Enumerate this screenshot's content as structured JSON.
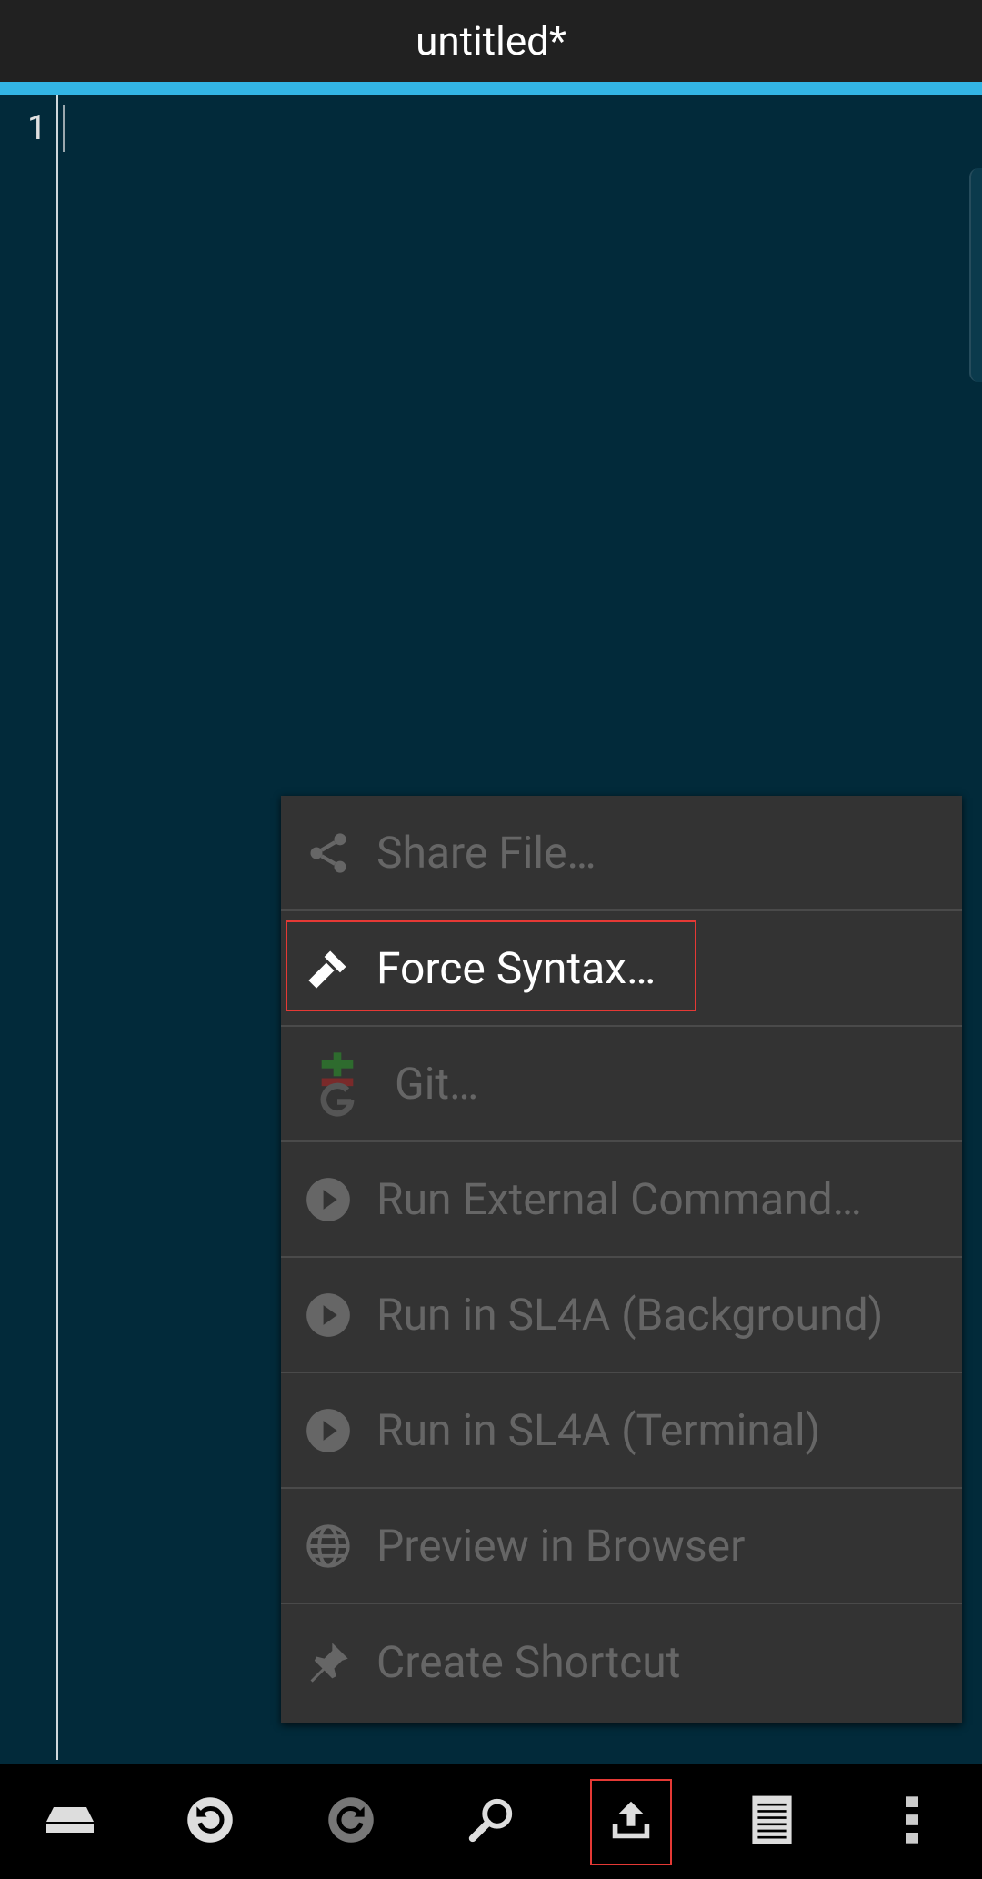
{
  "window": {
    "title": "untitled*"
  },
  "editor": {
    "line_numbers": [
      "1"
    ]
  },
  "menu": {
    "items": [
      {
        "label": "Share File…",
        "icon": "share-icon",
        "enabled": false
      },
      {
        "label": "Force Syntax…",
        "icon": "hammer-icon",
        "enabled": true
      },
      {
        "label": "Git…",
        "icon": "git-icon",
        "enabled": false
      },
      {
        "label": "Run External Command…",
        "icon": "play-icon",
        "enabled": false
      },
      {
        "label": "Run in SL4A (Background)",
        "icon": "play-icon",
        "enabled": false
      },
      {
        "label": "Run in SL4A (Terminal)",
        "icon": "play-icon",
        "enabled": false
      },
      {
        "label": "Preview in Browser",
        "icon": "globe-icon",
        "enabled": false
      },
      {
        "label": "Create Shortcut",
        "icon": "pin-icon",
        "enabled": false
      }
    ]
  },
  "toolbar": {
    "buttons": [
      "drive-icon",
      "undo-icon",
      "redo-icon",
      "search-icon",
      "upload-icon",
      "document-icon",
      "overflow-icon"
    ]
  },
  "colors": {
    "titlebar": "#212121",
    "accent": "#33b5e5",
    "editor_bg": "#022a3a",
    "menu_bg": "#333333",
    "highlight": "#e53935"
  }
}
